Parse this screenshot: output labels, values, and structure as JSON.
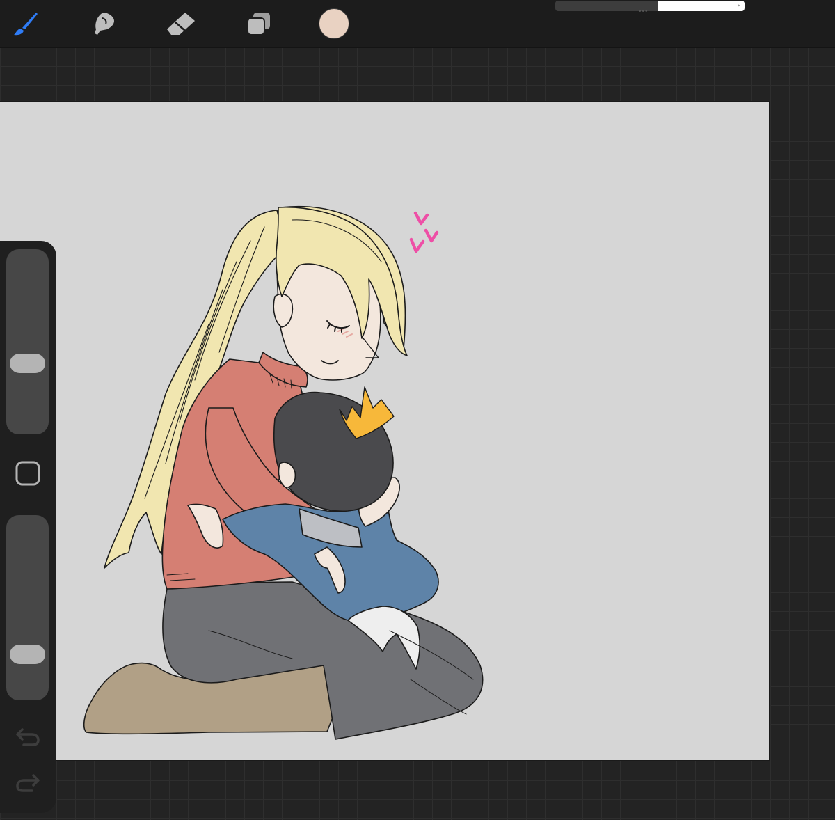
{
  "app": {
    "toolbar": {
      "tools": [
        {
          "name": "paint",
          "icon": "brush-icon",
          "active": true
        },
        {
          "name": "smudge",
          "icon": "smudge-icon",
          "active": false
        },
        {
          "name": "erase",
          "icon": "eraser-icon",
          "active": false
        },
        {
          "name": "layers",
          "icon": "layers-icon",
          "active": false
        }
      ],
      "current_color": "#e9d2c2",
      "active_tool_color": "#2f7cf6"
    },
    "status": {
      "progress": 0.46
    }
  },
  "sidebar": {
    "brush_size": {
      "icon": "brush-size-slider",
      "value": 0.63
    },
    "modify_button": {
      "icon": "square-icon"
    },
    "brush_opacity": {
      "icon": "opacity-slider",
      "value": 0.78
    },
    "undo": {
      "icon": "undo-icon"
    },
    "redo": {
      "icon": "redo-icon"
    }
  },
  "canvas": {
    "background": "#d6d6d6",
    "artwork": {
      "icon": "illustration-woman-hugging-child",
      "palette": {
        "hair": "#f1e6b0",
        "skin": "#f3e7dd",
        "sweater": "#d57f73",
        "pants": "#707175",
        "boots": "#b1a086",
        "child_hair": "#4a4a4d",
        "child_coat": "#5e83a8",
        "crown": "#f7b83a",
        "hearts": "#ee4fa6"
      }
    }
  }
}
